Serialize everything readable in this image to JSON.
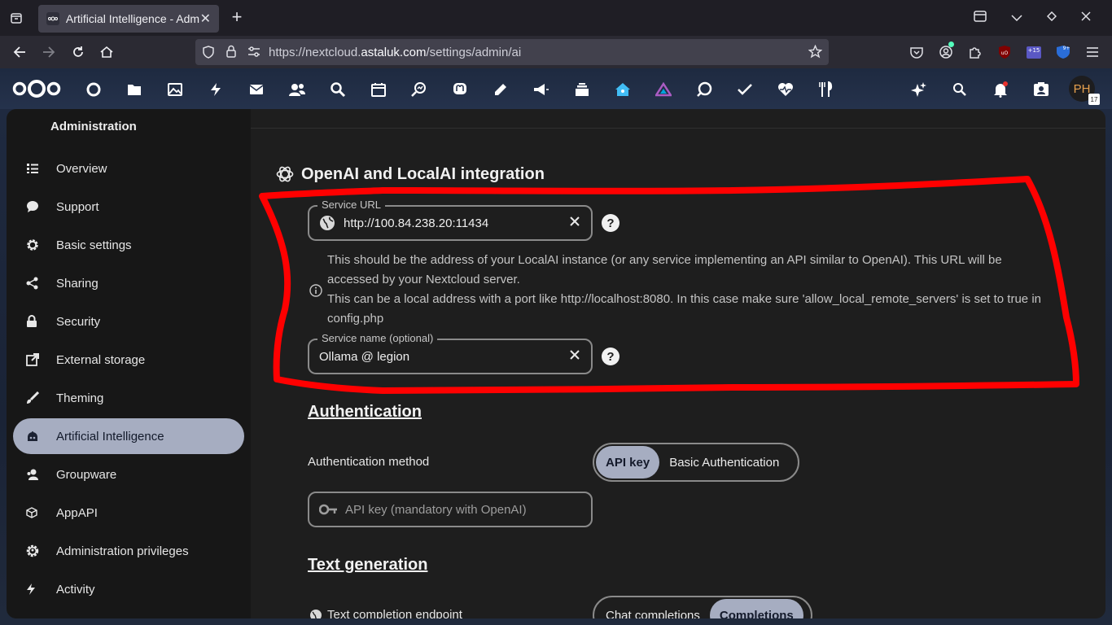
{
  "browser": {
    "tab_title": "Artificial Intelligence - Adm",
    "url_prefix": "https://nextcloud.",
    "url_domain": "astaluk.com",
    "url_path": "/settings/admin/ai",
    "ext_badges": [
      "+15",
      "9+"
    ]
  },
  "nc": {
    "avatar_initials": "PH",
    "calendar_badge": "17"
  },
  "sidebar": {
    "heading": "Administration",
    "items": [
      {
        "label": "Overview"
      },
      {
        "label": "Support"
      },
      {
        "label": "Basic settings"
      },
      {
        "label": "Sharing"
      },
      {
        "label": "Security"
      },
      {
        "label": "External storage"
      },
      {
        "label": "Theming"
      },
      {
        "label": "Artificial Intelligence"
      },
      {
        "label": "Groupware"
      },
      {
        "label": "AppAPI"
      },
      {
        "label": "Administration privileges"
      },
      {
        "label": "Activity"
      }
    ]
  },
  "main": {
    "section_title": "OpenAI and LocalAI integration",
    "service_url": {
      "legend": "Service URL",
      "value": "http://100.84.238.20:11434"
    },
    "hint_line1": "This should be the address of your LocalAI instance (or any service implementing an API similar to OpenAI). This URL will be",
    "hint_line2": "accessed by your Nextcloud server.",
    "hint_line3": "This can be a local address with a port like http://localhost:8080. In this case make sure 'allow_local_remote_servers' is set to true in",
    "hint_line4": "config.php",
    "service_name": {
      "legend": "Service name (optional)",
      "value": "Ollama @ legion"
    },
    "auth_heading": "Authentication",
    "auth_method_label": "Authentication method",
    "auth_options": [
      "API key",
      "Basic Authentication"
    ],
    "api_key_placeholder": "API key (mandatory with OpenAI)",
    "textgen_heading": "Text generation",
    "endpoint_label": "Text completion endpoint",
    "endpoint_options": [
      "Chat completions",
      "Completions"
    ]
  },
  "colors": {
    "accent": "#a6adc1",
    "annotation": "#ff0000"
  }
}
